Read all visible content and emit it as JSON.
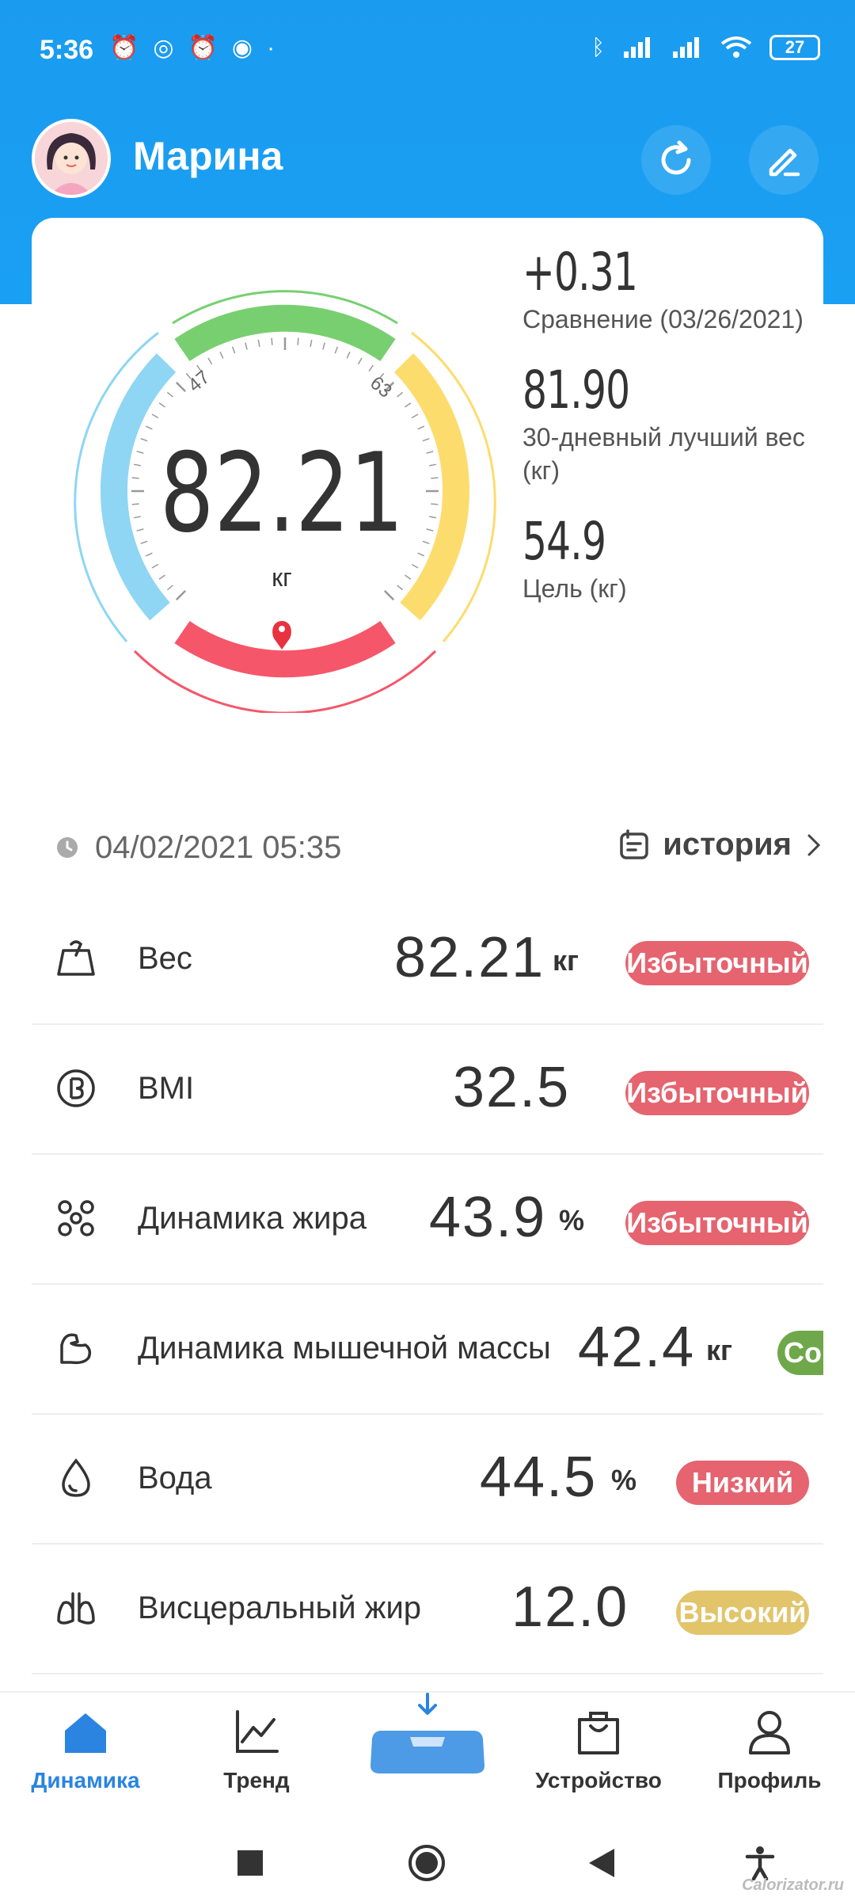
{
  "status_bar": {
    "time": "5:36",
    "battery": "27"
  },
  "profile": {
    "name": "Марина"
  },
  "gauge": {
    "value": "82.21",
    "unit": "кг",
    "tick_min": "47",
    "tick_max": "63",
    "marker_fraction": 0.5
  },
  "side_stats": [
    {
      "value": "+0.31",
      "label": "Сравнение (03/26/2021)"
    },
    {
      "value": "81.90",
      "label": "30-дневный лучший вес (кг)"
    },
    {
      "value": "54.9",
      "label": "Цель (кг)"
    }
  ],
  "measurement": {
    "datetime": "04/02/2021 05:35",
    "history_label": "история"
  },
  "metrics": [
    {
      "name": "Вес",
      "value": "82.21",
      "unit": "кг",
      "status": "Избыточный",
      "status_color": "#e5646f",
      "icon": "scale-icon"
    },
    {
      "name": "BMI",
      "value": "32.5",
      "unit": "",
      "status": "Избыточный",
      "status_color": "#e5646f",
      "icon": "bmi-icon"
    },
    {
      "name": "Динамика жира",
      "value": "43.9",
      "unit": "%",
      "status": "Избыточный",
      "status_color": "#e5646f",
      "icon": "fat-icon"
    },
    {
      "name": "Динамика мышечной массы",
      "value": "42.4",
      "unit": "кг",
      "status": "Совер",
      "status_color": "#6fa84a",
      "icon": "muscle-icon"
    },
    {
      "name": "Вода",
      "value": "44.5",
      "unit": "%",
      "status": "Низкий",
      "status_color": "#e5646f",
      "icon": "water-drop-icon"
    },
    {
      "name": "Висцеральный жир",
      "value": "12.0",
      "unit": "",
      "status": "Высокий",
      "status_color": "#e2c46b",
      "icon": "lungs-icon"
    }
  ],
  "bottom_nav": [
    {
      "label": "Динамика",
      "active": true,
      "icon": "home-icon"
    },
    {
      "label": "Тренд",
      "active": false,
      "icon": "trend-chart-icon"
    },
    {
      "label": "",
      "active": false,
      "icon": "scale-device-icon"
    },
    {
      "label": "Устройство",
      "active": false,
      "icon": "shopping-bag-icon"
    },
    {
      "label": "Профиль",
      "active": false,
      "icon": "person-icon"
    }
  ],
  "colors": {
    "header_blue": "#1a9bf0",
    "accent_blue": "#2a84e0",
    "gauge_green": "#78cf70",
    "gauge_yellow": "#fddc6e",
    "gauge_red": "#f5566a",
    "gauge_blue": "#8ed6f3"
  },
  "watermark": "Calorizator.ru"
}
